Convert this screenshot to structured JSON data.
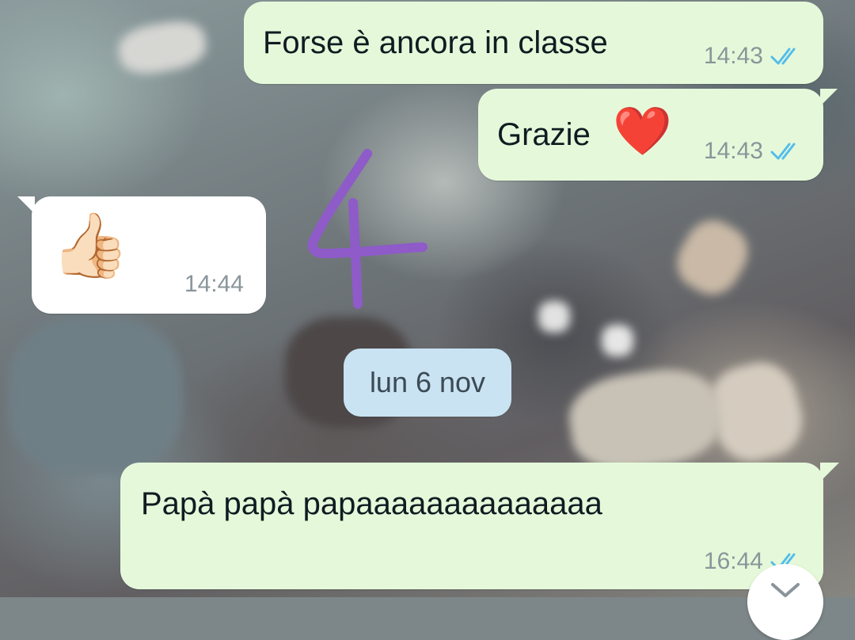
{
  "messages": [
    {
      "direction": "outgoing",
      "text": "Forse è ancora in classe",
      "time": "14:43",
      "status": "read"
    },
    {
      "direction": "outgoing",
      "text": "Grazie",
      "emoji": "❤️",
      "time": "14:43",
      "status": "read"
    },
    {
      "direction": "incoming",
      "emoji": "👍🏻",
      "time": "14:44"
    },
    {
      "direction": "outgoing",
      "text": "Papà papà papaaaaaaaaaaaaaa",
      "time": "16:44",
      "status": "read"
    }
  ],
  "date_separator": "lun 6 nov",
  "annotation": {
    "text": "4",
    "color": "#8e5bc9"
  },
  "colors": {
    "outgoing_bubble": "#e5f9da",
    "incoming_bubble": "#ffffff",
    "date_chip": "#c9e3f2",
    "read_ticks": "#53bdeb"
  },
  "icons": {
    "read_status": "double-check-icon",
    "scroll_down": "chevron-down-icon"
  }
}
